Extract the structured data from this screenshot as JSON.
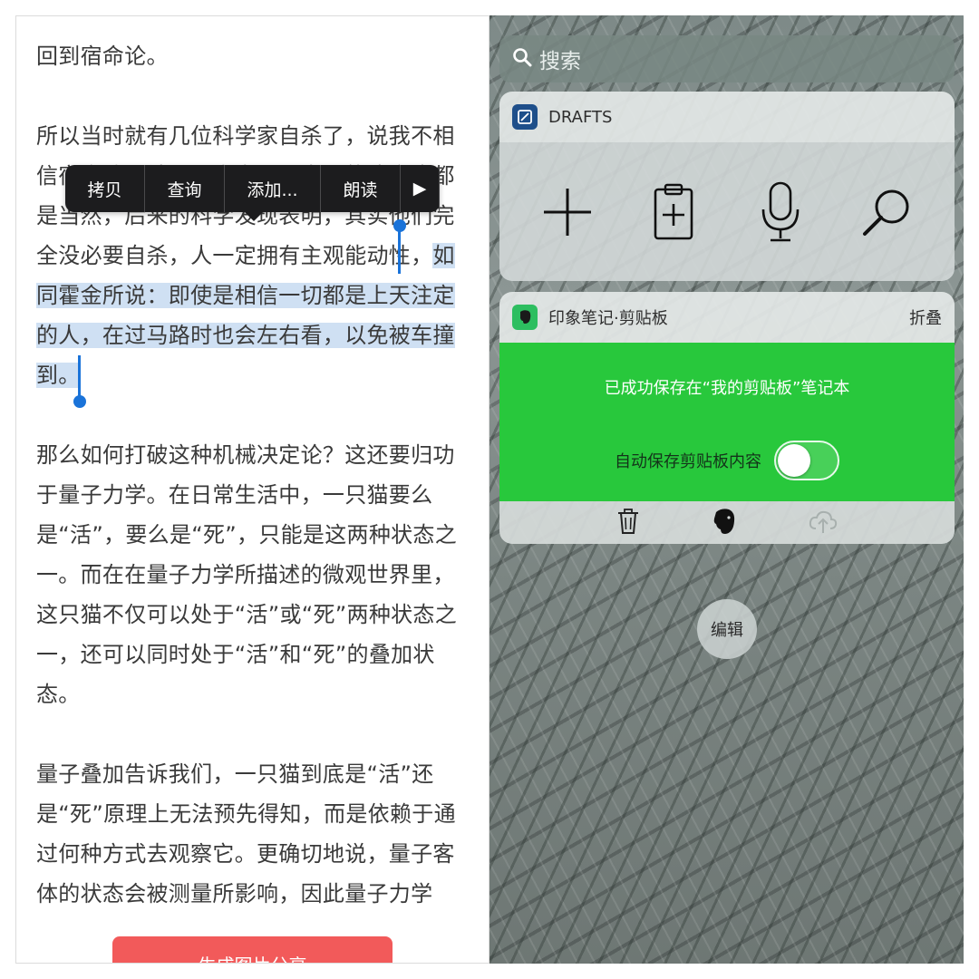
{
  "reader": {
    "para1": "回到宿命论。",
    "para2": {
      "pre": "所以当时就有几位科学家自杀了，说我不相信宿命论，结果后来发现，自己的决定也都是当然，后来的科学发现表明，其实他们完全没必要自杀，人一定拥有主观能动性，",
      "highlight": "如同霍金所说：即使是相信一切都是上天注定的人，在过马路时也会左右看，以免被车撞到。"
    },
    "para3": "那么如何打破这种机械决定论？这还要归功于量子力学。在日常生活中，一只猫要么是“活”，要么是“死”，只能是这两种状态之一。而在在量子力学所描述的微观世界里，这只猫不仅可以处于“活”或“死”两种状态之一，还可以同时处于“活”和“死”的叠加状态。",
    "para4": "量子叠加告诉我们，一只猫到底是“活”还是“死”原理上无法预先得知，而是依赖于通过何种方式去观察它。更确切地说，量子客体的状态会被测量所影响，因此量子力学",
    "share_button": "生成图片分享"
  },
  "edit_menu": {
    "copy": "拷贝",
    "lookup": "查询",
    "add": "添加...",
    "speak": "朗读",
    "more": "▶"
  },
  "today_view": {
    "search_placeholder": "搜索",
    "drafts": {
      "title": "DRAFTS",
      "actions": [
        "new-draft",
        "clipboard",
        "dictation",
        "search"
      ]
    },
    "evernote": {
      "title": "印象笔记·剪贴板",
      "collapse": "折叠",
      "saved_message": "已成功保存在“我的剪贴板”笔记本",
      "autosave_label": "自动保存剪贴板内容",
      "autosave_on": false,
      "green": "#28c83c"
    },
    "edit_button": "编辑"
  }
}
